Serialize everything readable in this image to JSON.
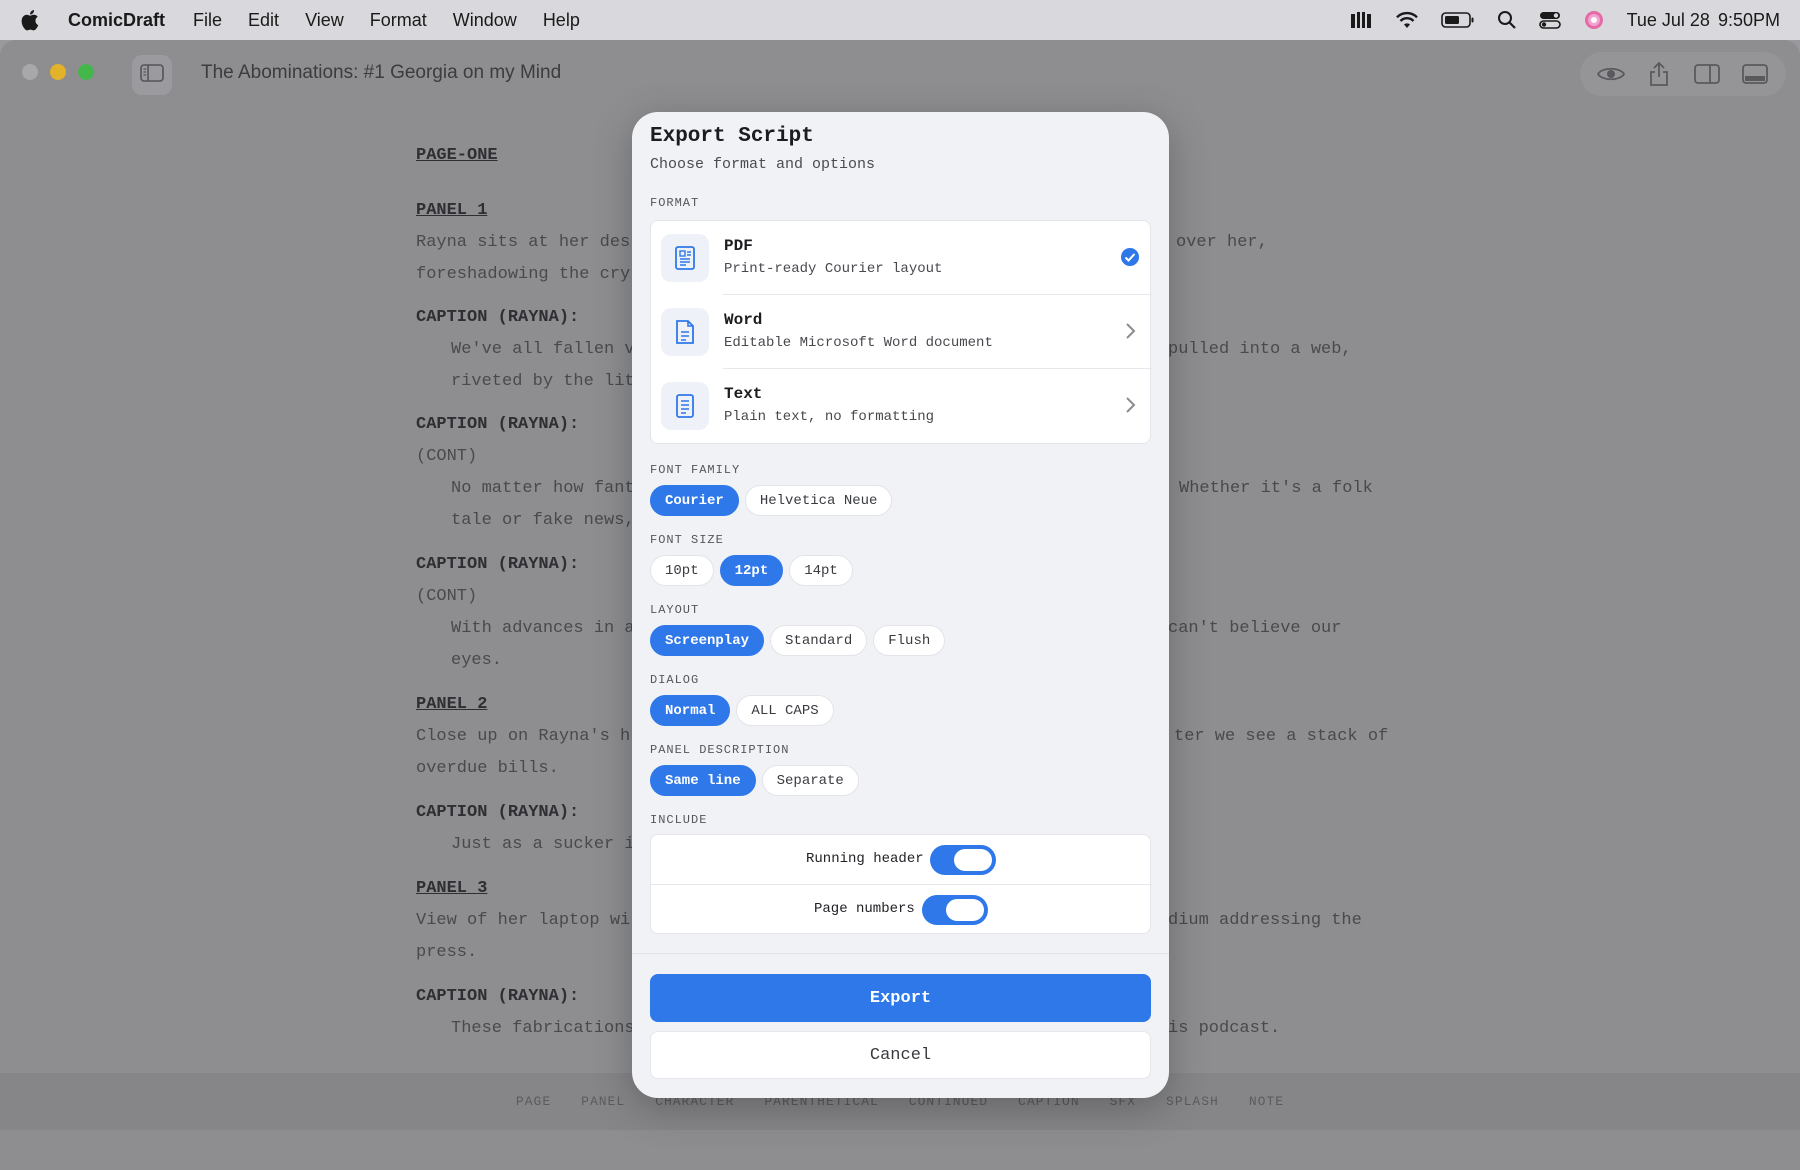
{
  "menubar": {
    "app_name": "ComicDraft",
    "items": [
      "File",
      "Edit",
      "View",
      "Format",
      "Window",
      "Help"
    ],
    "date": "Tue Jul 28",
    "time": "9:50PM"
  },
  "window": {
    "title": "The Abominations: #1 Georgia on my Mind"
  },
  "script": {
    "lines": [
      "PAGE-ONE",
      "PANEL 1",
      "Rayna sits at her des",
      "over her,",
      "foreshadowing the cry",
      "CAPTION (RAYNA):",
      "We've all fallen v",
      "pulled into a web,",
      "riveted by the lit",
      "CAPTION (RAYNA):",
      "(CONT)",
      "No matter how fant",
      "Whether it's a folk",
      "tale or fake news,",
      "CAPTION (RAYNA):",
      "(CONT)",
      "With advances in a",
      "can't believe our",
      "eyes.",
      "PANEL 2",
      "Close up on Rayna's h",
      "ter we see a stack of",
      "overdue bills.",
      "CAPTION (RAYNA):",
      "Just as a sucker i",
      "PANEL 3",
      "View of her laptop wi",
      "dium addressing the",
      "press.",
      "CAPTION (RAYNA):",
      "These fabrications",
      "is podcast."
    ]
  },
  "bottombar": {
    "items": [
      "PAGE",
      "PANEL",
      "CHARACTER",
      "PARENTHETICAL",
      "CONTINUED",
      "CAPTION",
      "SFX",
      "SPLASH",
      "NOTE"
    ]
  },
  "modal": {
    "title": "Export Script",
    "subtitle": "Choose format and options",
    "format_label": "FORMAT",
    "formats": [
      {
        "name": "PDF",
        "desc": "Print-ready Courier layout",
        "selected": true
      },
      {
        "name": "Word",
        "desc": "Editable Microsoft Word document",
        "selected": false
      },
      {
        "name": "Text",
        "desc": "Plain text, no formatting",
        "selected": false
      }
    ],
    "font_family_label": "FONT FAMILY",
    "font_family_options": [
      "Courier",
      "Helvetica Neue"
    ],
    "font_size_label": "FONT SIZE",
    "font_size_options": [
      "10pt",
      "12pt",
      "14pt"
    ],
    "layout_label": "LAYOUT",
    "layout_options": [
      "Screenplay",
      "Standard",
      "Flush"
    ],
    "dialog_label": "DIALOG",
    "dialog_options": [
      "Normal",
      "ALL CAPS"
    ],
    "panel_desc_label": "PANEL DESCRIPTION",
    "panel_desc_options": [
      "Same line",
      "Separate"
    ],
    "include_label": "INCLUDE",
    "running_header_label": "Running header",
    "running_header_on": true,
    "page_numbers_label": "Page numbers",
    "page_numbers_on": true,
    "export_label": "Export",
    "cancel_label": "Cancel"
  },
  "colors": {
    "accent": "#2f78ea",
    "modal_bg": "#f1f2f6"
  }
}
